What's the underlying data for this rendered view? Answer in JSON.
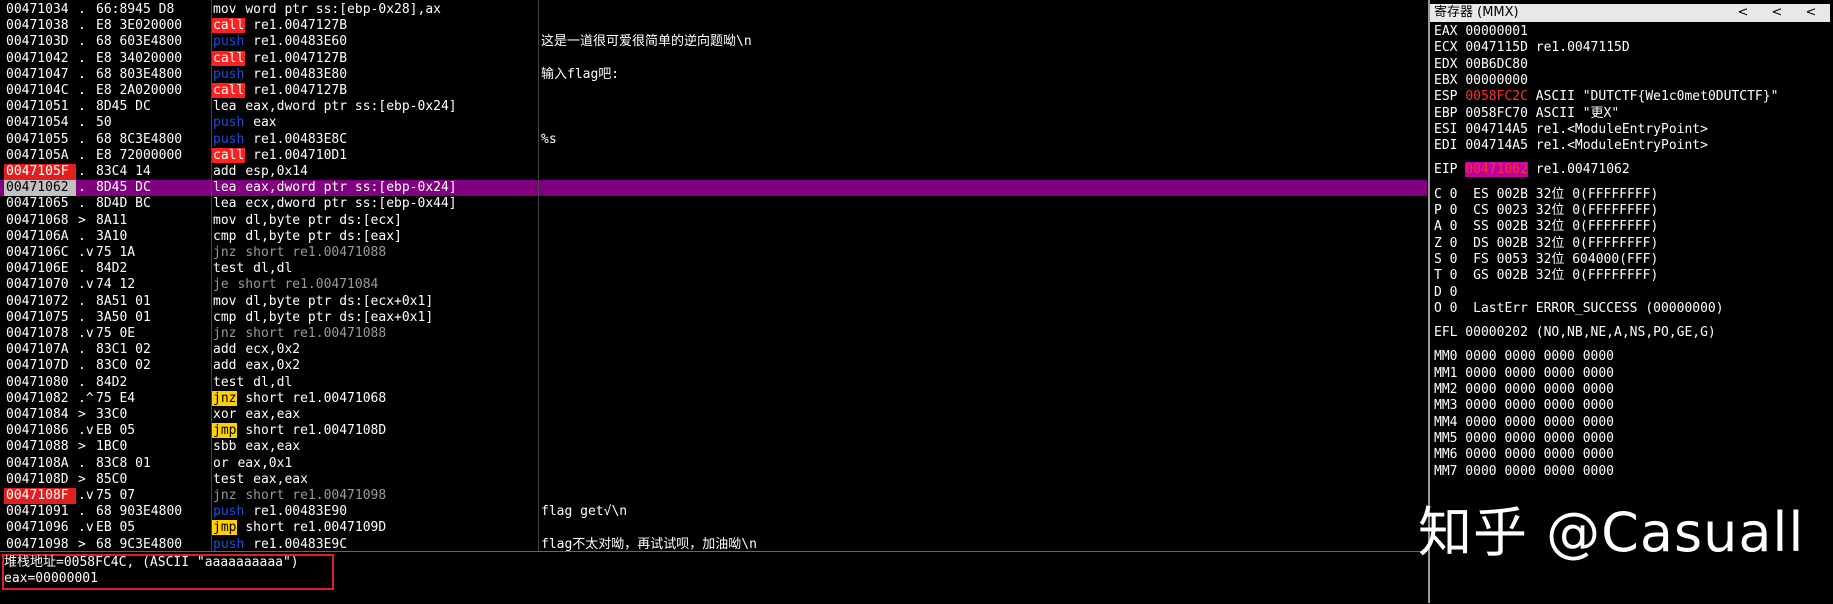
{
  "disasm": {
    "rows": [
      {
        "addr": "00471034",
        "mark": ".",
        "hex": "66:8945 D8",
        "op": "mov",
        "opclass": "mov",
        "args": "word ptr ss:[ebp-0x28],ax",
        "comment": "",
        "addr_style": ""
      },
      {
        "addr": "00471038",
        "mark": ".",
        "hex": "E8 3E020000",
        "op": "call",
        "opclass": "call",
        "args": "re1.0047127B",
        "comment": "",
        "addr_style": ""
      },
      {
        "addr": "0047103D",
        "mark": ".",
        "hex": "68 603E4800",
        "op": "push",
        "opclass": "push",
        "args": "re1.00483E60",
        "comment": "这是一道很可爱很简单的逆向题呦\\n",
        "addr_style": ""
      },
      {
        "addr": "00471042",
        "mark": ".",
        "hex": "E8 34020000",
        "op": "call",
        "opclass": "call",
        "args": "re1.0047127B",
        "comment": "",
        "addr_style": ""
      },
      {
        "addr": "00471047",
        "mark": ".",
        "hex": "68 803E4800",
        "op": "push",
        "opclass": "push",
        "args": "re1.00483E80",
        "comment": "输入flag吧:",
        "addr_style": ""
      },
      {
        "addr": "0047104C",
        "mark": ".",
        "hex": "E8 2A020000",
        "op": "call",
        "opclass": "call",
        "args": "re1.0047127B",
        "comment": "",
        "addr_style": ""
      },
      {
        "addr": "00471051",
        "mark": ".",
        "hex": "8D45 DC",
        "op": "lea",
        "opclass": "lea",
        "args": "eax,dword ptr ss:[ebp-0x24]",
        "comment": "",
        "addr_style": ""
      },
      {
        "addr": "00471054",
        "mark": ".",
        "hex": "50",
        "op": "push",
        "opclass": "push",
        "args": "eax",
        "comment": "",
        "addr_style": ""
      },
      {
        "addr": "00471055",
        "mark": ".",
        "hex": "68 8C3E4800",
        "op": "push",
        "opclass": "push",
        "args": "re1.00483E8C",
        "comment": "%s",
        "addr_style": ""
      },
      {
        "addr": "0047105A",
        "mark": ".",
        "hex": "E8 72000000",
        "op": "call",
        "opclass": "call",
        "args": "re1.004710D1",
        "comment": "",
        "addr_style": ""
      },
      {
        "addr": "0047105F",
        "mark": ".",
        "hex": "83C4 14",
        "op": "add",
        "opclass": "add",
        "args": "esp,0x14",
        "comment": "",
        "addr_style": "bp"
      },
      {
        "addr": "00471062",
        "mark": ".",
        "hex": "8D45 DC",
        "op": "lea",
        "opclass": "lea",
        "args": "eax,dword ptr ss:[ebp-0x24]",
        "comment": "",
        "addr_style": "sel"
      },
      {
        "addr": "00471065",
        "mark": ".",
        "hex": "8D4D BC",
        "op": "lea",
        "opclass": "lea",
        "args": "ecx,dword ptr ss:[ebp-0x44]",
        "comment": "",
        "addr_style": ""
      },
      {
        "addr": "00471068",
        "mark": ">",
        "hex": "8A11",
        "op": "mov",
        "opclass": "mov",
        "args": "dl,byte ptr ds:[ecx]",
        "comment": "",
        "addr_style": ""
      },
      {
        "addr": "0047106A",
        "mark": ".",
        "hex": "3A10",
        "op": "cmp",
        "opclass": "cmp",
        "args": "dl,byte ptr ds:[eax]",
        "comment": "",
        "addr_style": ""
      },
      {
        "addr": "0047106C",
        "mark": ".v",
        "hex": "75 1A",
        "op": "jnz",
        "opclass": "jnz",
        "args": "short re1.00471088",
        "comment": "",
        "addr_style": ""
      },
      {
        "addr": "0047106E",
        "mark": ".",
        "hex": "84D2",
        "op": "test",
        "opclass": "test",
        "args": "dl,dl",
        "comment": "",
        "addr_style": ""
      },
      {
        "addr": "00471070",
        "mark": ".v",
        "hex": "74 12",
        "op": "je",
        "opclass": "je",
        "args": "short re1.00471084",
        "comment": "",
        "addr_style": ""
      },
      {
        "addr": "00471072",
        "mark": ".",
        "hex": "8A51 01",
        "op": "mov",
        "opclass": "mov",
        "args": "dl,byte ptr ds:[ecx+0x1]",
        "comment": "",
        "addr_style": ""
      },
      {
        "addr": "00471075",
        "mark": ".",
        "hex": "3A50 01",
        "op": "cmp",
        "opclass": "cmp",
        "args": "dl,byte ptr ds:[eax+0x1]",
        "comment": "",
        "addr_style": ""
      },
      {
        "addr": "00471078",
        "mark": ".v",
        "hex": "75 0E",
        "op": "jnz",
        "opclass": "jnz",
        "args": "short re1.00471088",
        "comment": "",
        "addr_style": ""
      },
      {
        "addr": "0047107A",
        "mark": ".",
        "hex": "83C1 02",
        "op": "add",
        "opclass": "add",
        "args": "ecx,0x2",
        "comment": "",
        "addr_style": ""
      },
      {
        "addr": "0047107D",
        "mark": ".",
        "hex": "83C0 02",
        "op": "add",
        "opclass": "add",
        "args": "eax,0x2",
        "comment": "",
        "addr_style": ""
      },
      {
        "addr": "00471080",
        "mark": ".",
        "hex": "84D2",
        "op": "test",
        "opclass": "test",
        "args": "dl,dl",
        "comment": "",
        "addr_style": ""
      },
      {
        "addr": "00471082",
        "mark": ".^",
        "hex": "75 E4",
        "op": "jnz",
        "opclass": "jmp",
        "args": "short re1.00471068",
        "comment": "",
        "addr_style": ""
      },
      {
        "addr": "00471084",
        "mark": ">",
        "hex": "33C0",
        "op": "xor",
        "opclass": "xor",
        "args": "eax,eax",
        "comment": "",
        "addr_style": ""
      },
      {
        "addr": "00471086",
        "mark": ".v",
        "hex": "EB 05",
        "op": "jmp",
        "opclass": "jmp",
        "args": "short re1.0047108D",
        "comment": "",
        "addr_style": ""
      },
      {
        "addr": "00471088",
        "mark": ">",
        "hex": "1BC0",
        "op": "sbb",
        "opclass": "sbb",
        "args": "eax,eax",
        "comment": "",
        "addr_style": ""
      },
      {
        "addr": "0047108A",
        "mark": ".",
        "hex": "83C8 01",
        "op": "or",
        "opclass": "or",
        "args": "eax,0x1",
        "comment": "",
        "addr_style": ""
      },
      {
        "addr": "0047108D",
        "mark": ">",
        "hex": "85C0",
        "op": "test",
        "opclass": "test",
        "args": "eax,eax",
        "comment": "",
        "addr_style": ""
      },
      {
        "addr": "0047108F",
        "mark": ".v",
        "hex": "75 07",
        "op": "jnz",
        "opclass": "jnz",
        "args": "short re1.00471098",
        "comment": "",
        "addr_style": "bp"
      },
      {
        "addr": "00471091",
        "mark": ".",
        "hex": "68 903E4800",
        "op": "push",
        "opclass": "push",
        "args": "re1.00483E90",
        "comment": "flag get√\\n",
        "addr_style": ""
      },
      {
        "addr": "00471096",
        "mark": ".v",
        "hex": "EB 05",
        "op": "jmp",
        "opclass": "jmp",
        "args": "short re1.0047109D",
        "comment": "",
        "addr_style": ""
      },
      {
        "addr": "00471098",
        "mark": ">",
        "hex": "68 9C3E4800",
        "op": "push",
        "opclass": "push",
        "args": "re1.00483E9C",
        "comment": "flag不太对呦，再试试呗，加油呦\\n",
        "addr_style": ""
      }
    ]
  },
  "info": {
    "line1": "堆栈地址=0058FC4C, (ASCII \"aaaaaaaaaa\")",
    "line2": "eax=00000001"
  },
  "registers": {
    "title": "寄存器 (MMX)",
    "buttons": [
      "<",
      "<",
      "<"
    ],
    "gp": [
      {
        "name": "EAX",
        "value": "00000001",
        "note": ""
      },
      {
        "name": "ECX",
        "value": "0047115D",
        "note": "re1.0047115D"
      },
      {
        "name": "EDX",
        "value": "00B6DC80",
        "note": ""
      },
      {
        "name": "EBX",
        "value": "00000000",
        "note": ""
      },
      {
        "name": "ESP",
        "value": "0058FC2C",
        "note": "ASCII \"DUTCTF{We1c0met0DUTCTF}\"",
        "highlight": "red"
      },
      {
        "name": "EBP",
        "value": "0058FC70",
        "note": "ASCII \"更X\""
      },
      {
        "name": "ESI",
        "value": "004714A5",
        "note": "re1.<ModuleEntryPoint>"
      },
      {
        "name": "EDI",
        "value": "004714A5",
        "note": "re1.<ModuleEntryPoint>"
      }
    ],
    "eip": {
      "name": "EIP",
      "value": "00471062",
      "note": "re1.00471062"
    },
    "flags": [
      "C 0  ES 002B 32位 0(FFFFFFFF)",
      "P 0  CS 0023 32位 0(FFFFFFFF)",
      "A 0  SS 002B 32位 0(FFFFFFFF)",
      "Z 0  DS 002B 32位 0(FFFFFFFF)",
      "S 0  FS 0053 32位 604000(FFF)",
      "T 0  GS 002B 32位 0(FFFFFFFF)",
      "D 0",
      "O 0  LastErr ERROR_SUCCESS (00000000)"
    ],
    "efl": "EFL 00000202 (NO,NB,NE,A,NS,PO,GE,G)",
    "mmx": [
      "MM0 0000 0000 0000 0000",
      "MM1 0000 0000 0000 0000",
      "MM2 0000 0000 0000 0000",
      "MM3 0000 0000 0000 0000",
      "MM4 0000 0000 0000 0000",
      "MM5 0000 0000 0000 0000",
      "MM6 0000 0000 0000 0000",
      "MM7 0000 0000 0000 0000"
    ]
  },
  "watermark": "知乎 @Casuall",
  "colors": {
    "selected_row": "#800080",
    "breakpoint": "#e02020",
    "call_bg": "#ff2020",
    "jmp_bg": "#ffd000",
    "push_fg": "#1c4fd6",
    "operand_green": "#3ad13a"
  }
}
